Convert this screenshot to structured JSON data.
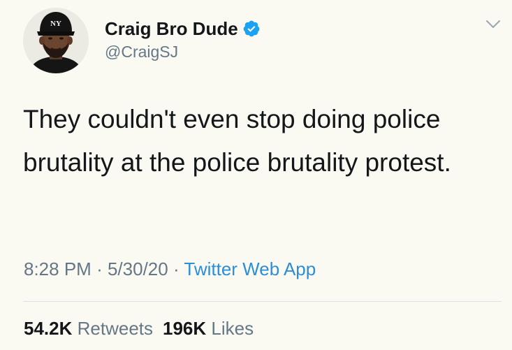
{
  "tweet": {
    "author": {
      "display_name": "Craig Bro Dude",
      "handle": "@CraigSJ",
      "verified": true
    },
    "text": "They couldn't even stop doing police brutality at the police brutality protest.",
    "meta": {
      "time": "8:28 PM",
      "separator": "·",
      "date": "5/30/20",
      "source": "Twitter Web App"
    },
    "stats": {
      "retweets_count": "54.2K",
      "retweets_label": "Retweets",
      "likes_count": "196K",
      "likes_label": "Likes"
    }
  },
  "icons": {
    "verified": "verified-badge-icon",
    "chevron": "chevron-down-icon",
    "cap_logo": "ny-logo"
  },
  "colors": {
    "background": "#fbfaf2",
    "text": "#14171a",
    "secondary_text": "#657786",
    "link": "#2c8ed8",
    "verified_badge": "#1da1f2",
    "divider": "#dde2e6"
  }
}
